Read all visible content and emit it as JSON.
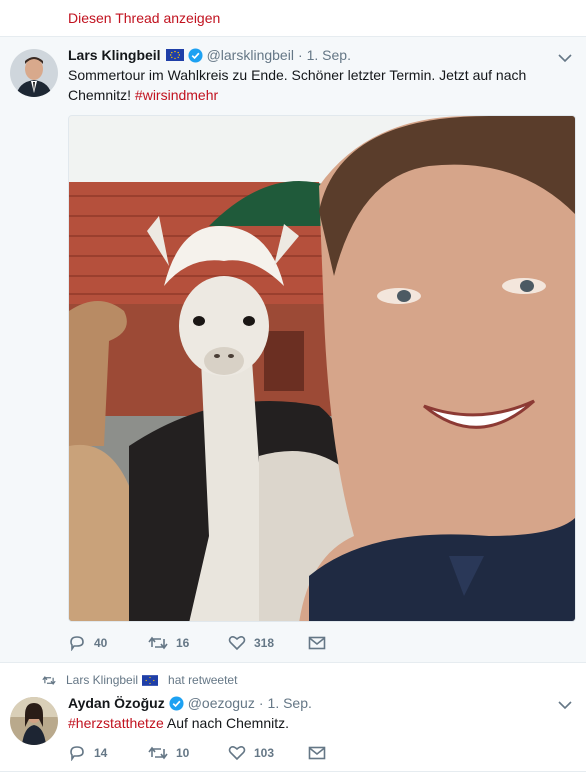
{
  "thread_link": "Diesen Thread anzeigen",
  "tweet1": {
    "name": "Lars Klingbeil",
    "handle": "@larsklingbeil",
    "separator": "·",
    "time": "1. Sep.",
    "text_plain": "Sommertour im Wahlkreis zu Ende. Schöner letzter Termin. Jetzt auf nach Chemnitz!",
    "hashtag": "#wirsindmehr",
    "replies": "40",
    "retweets": "16",
    "likes": "318",
    "icons": [
      "eu-flag-icon",
      "verified-icon",
      "chevron-down-icon",
      "reply-icon",
      "retweet-icon",
      "heart-icon",
      "mail-icon"
    ]
  },
  "tweet2": {
    "retweet_context_name": "Lars Klingbeil",
    "retweet_context_suffix": "hat retweetet",
    "name": "Aydan Özoğuz",
    "handle": "@oezoguz",
    "separator": "·",
    "time": "1. Sep.",
    "hashtag": "#herzstatthetze",
    "text_plain": " Auf nach Chemnitz.",
    "replies": "14",
    "retweets": "10",
    "likes": "103"
  },
  "colors": {
    "accent": "#c1121f",
    "muted": "#657786",
    "verified": "#1da1f2",
    "background": "#f5f8fa"
  }
}
